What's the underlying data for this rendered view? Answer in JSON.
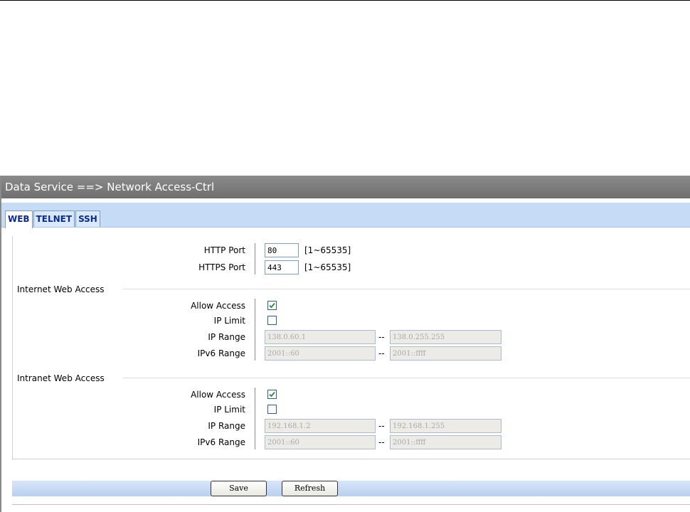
{
  "header": {
    "breadcrumb": "Data Service ==> Network Access-Ctrl"
  },
  "tabs": [
    {
      "label": "WEB",
      "active": true
    },
    {
      "label": "TELNET",
      "active": false
    },
    {
      "label": "SSH",
      "active": false
    }
  ],
  "ports": {
    "http_label": "HTTP Port",
    "http_value": "80",
    "http_range": "[1~65535]",
    "https_label": "HTTPS Port",
    "https_value": "443",
    "https_range": "[1~65535]"
  },
  "internet": {
    "title": "Internet Web Access",
    "allow_label": "Allow Access",
    "allow_checked": true,
    "iplimit_label": "IP Limit",
    "iplimit_checked": false,
    "iprange_label": "IP Range",
    "ip_from": "138.0.60.1",
    "ip_to": "138.0.255.255",
    "ipv6range_label": "IPv6 Range",
    "ipv6_from": "2001::60",
    "ipv6_to": "2001::ffff",
    "dash": "--"
  },
  "intranet": {
    "title": "Intranet Web Access",
    "allow_label": "Allow Access",
    "allow_checked": true,
    "iplimit_label": "IP Limit",
    "iplimit_checked": false,
    "iprange_label": "IP Range",
    "ip_from": "192.168.1.2",
    "ip_to": "192.168.1.255",
    "ipv6range_label": "IPv6 Range",
    "ipv6_from": "2001::60",
    "ipv6_to": "2001::ffff",
    "dash": "--"
  },
  "buttons": {
    "save": "Save",
    "refresh": "Refresh"
  },
  "colors": {
    "accent": "#c6dcf6",
    "title_bar": "#7a7a7a",
    "tab_text": "#0a2a9a",
    "check": "#2e8b2e"
  }
}
